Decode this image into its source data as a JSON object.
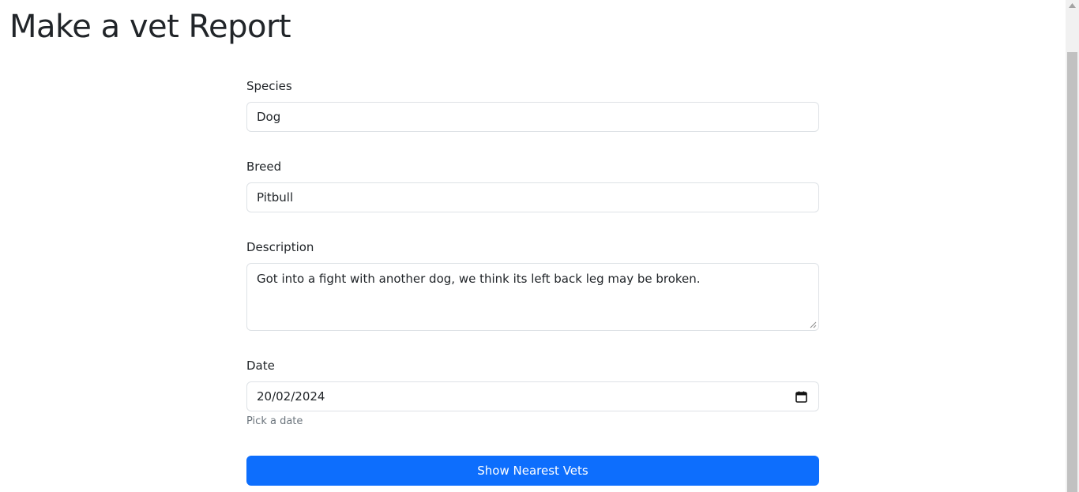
{
  "page": {
    "title": "Make a vet Report"
  },
  "form": {
    "species": {
      "label": "Species",
      "value": "Dog"
    },
    "breed": {
      "label": "Breed",
      "value": "Pitbull"
    },
    "description": {
      "label": "Description",
      "value": "Got into a fight with another dog, we think its left back leg may be broken."
    },
    "date": {
      "label": "Date",
      "value": "20/02/2024",
      "help": "Pick a date"
    },
    "submit_label": "Show Nearest Vets"
  },
  "colors": {
    "primary": "#0d6efd",
    "border": "#dee2e6",
    "muted": "#6c757d",
    "text": "#212529"
  },
  "icons": {
    "date_picker": "calendar-icon",
    "textarea_resize": "resize-grip-icon"
  }
}
